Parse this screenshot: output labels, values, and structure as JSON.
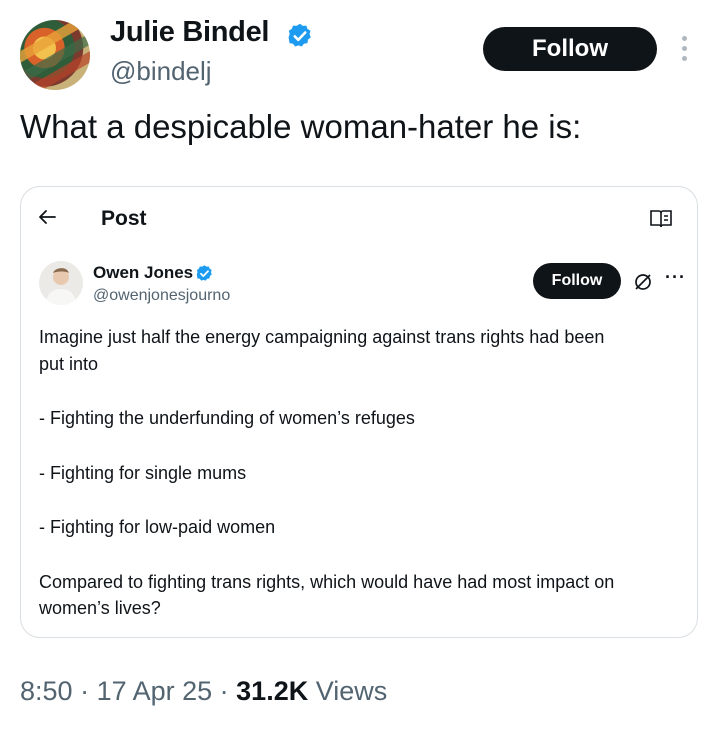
{
  "author": {
    "name": "Julie Bindel",
    "handle": "@bindelj",
    "follow_label": "Follow"
  },
  "tweet": {
    "text": "What a despicable woman-hater he is:"
  },
  "quoted": {
    "header_title": "Post",
    "name": "Owen Jones",
    "handle": "@owenjonesjourno",
    "follow_label": "Follow",
    "more_label": "···",
    "lines": [
      "Imagine just half the energy campaigning against trans rights had been",
      "put into",
      "- Fighting the underfunding of women’s refuges",
      "- Fighting for single mums",
      "- Fighting for low-paid women",
      "Compared to fighting trans rights, which would have had most impact on",
      "women’s lives?"
    ]
  },
  "footer": {
    "time": "8:50",
    "sep1": " · ",
    "date": "17 Apr 25",
    "sep2": " · ",
    "views_count": "31.2K",
    "views_label": " Views"
  },
  "colors": {
    "verified": "#1d9bf0",
    "text": "#0f1419",
    "muted": "#536471"
  }
}
